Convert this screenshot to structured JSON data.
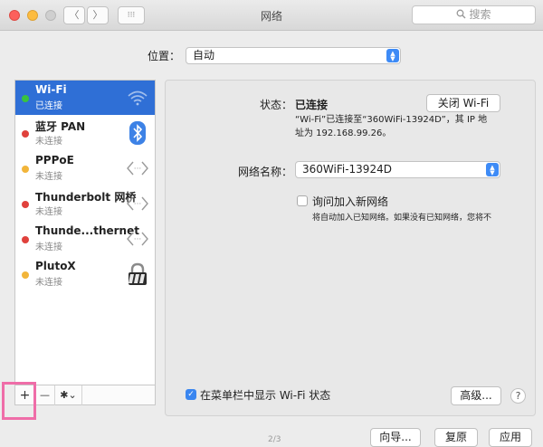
{
  "window": {
    "title": "网络"
  },
  "toolbar": {
    "back_glyph": "〈",
    "forward_glyph": "〉",
    "grid_glyph": "⁝⁝⁝",
    "search_placeholder": "搜索"
  },
  "location": {
    "label": "位置：",
    "value": "自动"
  },
  "sidebar": {
    "items": [
      {
        "name": "Wi-Fi",
        "status": "已连接",
        "dot_color": "#39c33f",
        "icon": "wifi-icon",
        "selected": true
      },
      {
        "name": "蓝牙 PAN",
        "status": "未连接",
        "dot_color": "#e0413c",
        "icon": "bluetooth-icon",
        "selected": false
      },
      {
        "name": "PPPoE",
        "status": "未连接",
        "dot_color": "#f2b53a",
        "icon": "network-arrows-icon",
        "selected": false
      },
      {
        "name": "Thunderbolt 网桥",
        "status": "未连接",
        "dot_color": "#e0413c",
        "icon": "network-arrows-icon",
        "selected": false
      },
      {
        "name": "Thunde...thernet",
        "status": "未连接",
        "dot_color": "#e0413c",
        "icon": "network-arrows-icon",
        "selected": false
      },
      {
        "name": "PlutoX",
        "status": "未连接",
        "dot_color": "#f2b53a",
        "icon": "lock-icon",
        "selected": false
      }
    ],
    "add_glyph": "+",
    "remove_glyph": "—",
    "action_glyph": "✱⌄"
  },
  "detail": {
    "status_label": "状态：",
    "status_value": "已连接",
    "turn_off_button": "关闭 Wi-Fi",
    "status_desc_line1": "“Wi-Fi”已连接至“360WiFi-13924D”，其 IP 地",
    "status_desc_line2": "址为 192.168.99.26。",
    "network_name_label": "网络名称：",
    "network_name_value": "360WiFi-13924D",
    "ask_join_label": "询问加入新网络",
    "ask_join_desc": "将自动加入已知网络。如果没有已知网络，您将不",
    "show_in_menubar_label": "在菜单栏中显示 Wi-Fi 状态",
    "advanced_button": "高级...",
    "help_glyph": "?"
  },
  "footer": {
    "assistant_button": "向导...",
    "revert_button": "复原",
    "apply_button": "应用",
    "page_indicator": "2/3"
  },
  "colors": {
    "accent": "#2f6fd6",
    "highlight_box": "#ef6da8"
  }
}
